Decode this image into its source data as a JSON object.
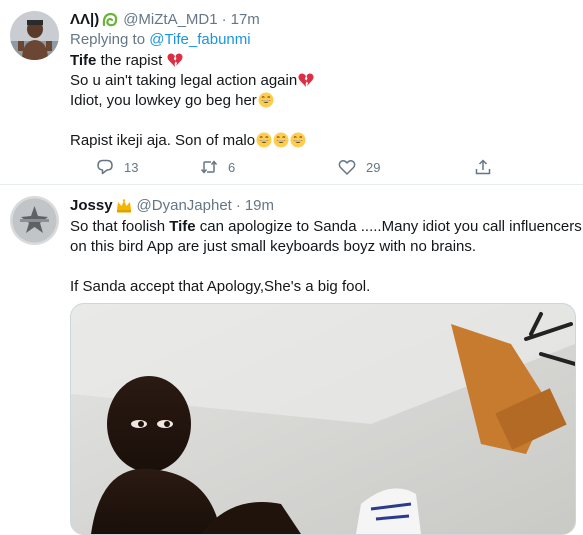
{
  "tweets": [
    {
      "name": "ΛΛ|)",
      "handle": "@MiZtA_MD1",
      "separator": "·",
      "time": "17m",
      "reply_prefix": "Replying to",
      "reply_handle": "@Tife_fabunmi",
      "lines": {
        "l1_bold": "Tife",
        "l1_rest": " the rapist ",
        "l2": "So u ain't taking legal action again",
        "l3": "Idiot, you lowkey go beg her",
        "l5": "Rapist ikeji aja. Son of malo"
      },
      "actions": {
        "reply_count": "13",
        "retweet_count": "6",
        "like_count": "29"
      }
    },
    {
      "name": "Jossy",
      "handle": "@DyanJaphet",
      "separator": "·",
      "time": "19m",
      "lines": {
        "l1_pre": "So that foolish ",
        "l1_bold": "Tife",
        "l1_rest": " can apologize to Sanda .....Many idiot you call influencers",
        "l2": "on  this bird App are just small keyboards boyz with no brains.",
        "l4": "If Sanda accept that Apology,She's a big fool."
      }
    }
  ],
  "icons": {
    "reply": "reply-icon",
    "retweet": "retweet-icon",
    "like": "heart-icon",
    "share": "share-icon",
    "broken_heart": "broken-heart-emoji",
    "grin": "grinning-emoji",
    "crown": "crown-emoji"
  },
  "colors": {
    "link": "#1b95e0",
    "muted": "#657786",
    "text": "#14171a",
    "divider": "#e6ecf0"
  }
}
